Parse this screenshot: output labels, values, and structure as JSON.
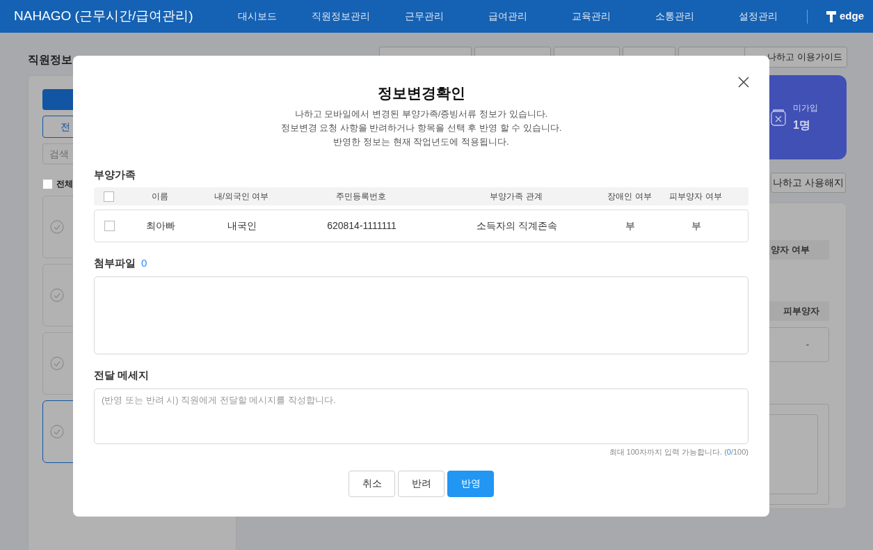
{
  "header": {
    "title": "NAHAGO (근무시간/급여관리)",
    "nav": [
      {
        "label": "대시보드"
      },
      {
        "label": "직원정보관리"
      },
      {
        "label": "근무관리"
      },
      {
        "label": "급여관리"
      },
      {
        "label": "교육관리"
      },
      {
        "label": "소통관리"
      },
      {
        "label": "설정관리"
      }
    ],
    "logo": "edge"
  },
  "page": {
    "title": "직원정보",
    "guide_button": "나하고 이용가이드",
    "stat_card": {
      "label": "미가입",
      "value": "1명"
    },
    "cancel_service_button": "나하고 사용해지",
    "sidebar": {
      "filter_button": "전",
      "search_placeholder": "검색",
      "select_all": {
        "label": "전체",
        "checked": false
      },
      "cards": [
        {
          "selected": false
        },
        {
          "selected": false
        },
        {
          "selected": false
        },
        {
          "selected": true
        }
      ]
    },
    "detail": {
      "column_header": "양자 여부",
      "dependent_header": "피부양자",
      "dependent_value": "-"
    }
  },
  "modal": {
    "title": "정보변경확인",
    "description": [
      "나하고 모바일에서 변경된 부양가족/증빙서류 정보가 있습니다.",
      "정보변경 요청 사항을 반려하거나 항목을 선택 후 반영 할 수 있습니다.",
      "반영한 정보는 현재 작업년도에 적용됩니다."
    ],
    "dependents": {
      "heading": "부양가족",
      "columns": [
        "이름",
        "내/외국인 여부",
        "주민등록번호",
        "부양가족 관계",
        "장애인 여부",
        "피부양자 여부"
      ],
      "all_checked": false,
      "rows": [
        {
          "checked": false,
          "cells": [
            "최아빠",
            "내국인",
            "620814-1111111",
            "소득자의 직계존속",
            "부",
            "부"
          ]
        }
      ]
    },
    "attachments": {
      "heading": "첨부파일",
      "count": "0"
    },
    "message": {
      "heading": "전달 메세지",
      "placeholder": "(반영 또는 반려 시) 직원에게 전달할 메시지를 작성합니다.",
      "limit_note": "최대 100자까지 입력 가능합니다. (",
      "count": "0",
      "limit_max": "/100)"
    },
    "buttons": [
      {
        "label": "취소",
        "kind": "secondary"
      },
      {
        "label": "반려",
        "kind": "secondary"
      },
      {
        "label": "반영",
        "kind": "primary"
      }
    ]
  }
}
